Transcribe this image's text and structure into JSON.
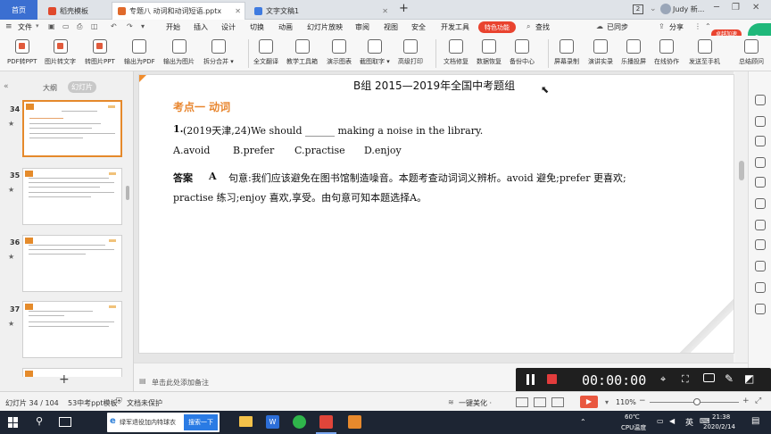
{
  "tabs": {
    "home": "首页",
    "items": [
      {
        "label": "稻壳模板",
        "color": "#e0492c"
      },
      {
        "label": "专题八    动词和动词短语.pptx",
        "color": "#e06a2c"
      },
      {
        "label": "文字文稿1",
        "color": "#3f7be0"
      }
    ],
    "add": "+",
    "badge": "2",
    "user": "Judy 新..."
  },
  "menu": {
    "file": "文件",
    "items": [
      "开始",
      "插入",
      "设计",
      "切换",
      "动画",
      "幻灯片放映",
      "审阅",
      "视图",
      "安全",
      "开发工具"
    ],
    "special": "特色功能",
    "search": "查找",
    "sync": "已同步",
    "share": "分享",
    "promo": "卓越加速"
  },
  "ribbon": [
    {
      "label": "PDF转PPT",
      "icon": "pdf-to-ppt-icon"
    },
    {
      "label": "图片转文字",
      "icon": "image-to-text-icon"
    },
    {
      "label": "转图片PPT",
      "icon": "to-image-ppt-icon"
    },
    {
      "label": "输出为PDF",
      "icon": "export-pdf-icon"
    },
    {
      "label": "输出为图片",
      "icon": "export-image-icon"
    },
    {
      "label": "拆分合并 ▾",
      "icon": "split-merge-icon"
    },
    {
      "label": "全文翻译",
      "icon": "translate-icon"
    },
    {
      "label": "教学工具箱",
      "icon": "teaching-toolbox-icon"
    },
    {
      "label": "演示图表",
      "icon": "chart-icon"
    },
    {
      "label": "截图取字 ▾",
      "icon": "screenshot-text-icon"
    },
    {
      "label": "高级打印",
      "icon": "print-icon"
    },
    {
      "label": "文档修复",
      "icon": "repair-icon"
    },
    {
      "label": "数据恢复",
      "icon": "data-recovery-icon"
    },
    {
      "label": "备份中心",
      "icon": "backup-icon"
    },
    {
      "label": "屏幕录制",
      "icon": "screen-record-icon"
    },
    {
      "label": "演讲实录",
      "icon": "speech-record-icon"
    },
    {
      "label": "乐播投屏",
      "icon": "cast-icon"
    },
    {
      "label": "在线协作",
      "icon": "collaborate-icon"
    },
    {
      "label": "发送至手机",
      "icon": "send-phone-icon"
    },
    {
      "label": "总结顾问",
      "icon": "advisor-icon"
    }
  ],
  "leftpanel": {
    "tab_outline": "大纲",
    "tab_slides": "幻灯片",
    "slides": [
      {
        "num": "34",
        "selected": true
      },
      {
        "num": "35",
        "selected": false
      },
      {
        "num": "36",
        "selected": false
      },
      {
        "num": "37",
        "selected": false
      }
    ],
    "add": "+"
  },
  "slide": {
    "heading": "B组   2015—2019年全国中考题组",
    "section": "考点一   动词",
    "q_num": "1.",
    "question": "(2019天津,24)We should ______ making a noise in the library.",
    "options": [
      "A.avoid",
      "B.prefer",
      "C.practise",
      "D.enjoy"
    ],
    "answer_label": "答案",
    "answer_letter": "A",
    "explanation_1": "句意:我们应该避免在图书馆制造噪音。本题考查动词词义辨析。avoid 避免;prefer 更喜欢;",
    "explanation_2": "practise 练习;enjoy 喜欢,享受。由句意可知本题选择A。"
  },
  "notes": {
    "placeholder": "单击此处添加备注"
  },
  "status": {
    "slide_count": "幻灯片 34 / 104",
    "template": "53中考ppt模板",
    "protect": "文档未保护",
    "beautify": "一键美化 ·",
    "zoom": "110%"
  },
  "recorder": {
    "time": "00:00:00"
  },
  "taskbar": {
    "ie_text": "绿军退役加内特球衣",
    "search_btn": "搜索一下",
    "temp": "60℃",
    "temp_label": "CPU温度",
    "lang": "英",
    "time": "21:38",
    "date": "2020/2/14"
  }
}
